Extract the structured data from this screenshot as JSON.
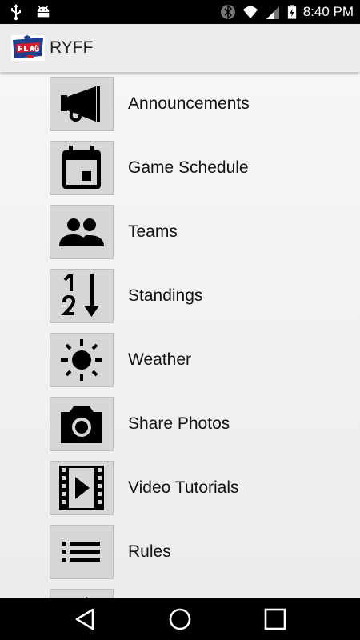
{
  "status_bar": {
    "time": "8:40 PM",
    "icons": [
      "usb-icon",
      "android-icon",
      "bluetooth-icon",
      "wifi-icon",
      "signal-icon",
      "battery-icon"
    ]
  },
  "app_bar": {
    "title": "RYFF",
    "logo_icon": "flag-football-logo"
  },
  "menu": {
    "items": [
      {
        "label": "Announcements",
        "icon": "megaphone-icon"
      },
      {
        "label": "Game Schedule",
        "icon": "calendar-icon"
      },
      {
        "label": "Teams",
        "icon": "people-icon"
      },
      {
        "label": "Standings",
        "icon": "sort-numeric-icon"
      },
      {
        "label": "Weather",
        "icon": "sun-icon"
      },
      {
        "label": "Share Photos",
        "icon": "camera-icon"
      },
      {
        "label": "Video Tutorials",
        "icon": "film-play-icon"
      },
      {
        "label": "Rules",
        "icon": "list-icon"
      },
      {
        "label": "",
        "icon": "pencil-icon"
      }
    ]
  },
  "nav_bar": {
    "buttons": [
      "back-icon",
      "home-icon",
      "recents-icon"
    ]
  },
  "colors": {
    "tile_bg": "#d6d6d6",
    "app_bar_bg": "#ececec",
    "system_bar_bg": "#000000"
  }
}
